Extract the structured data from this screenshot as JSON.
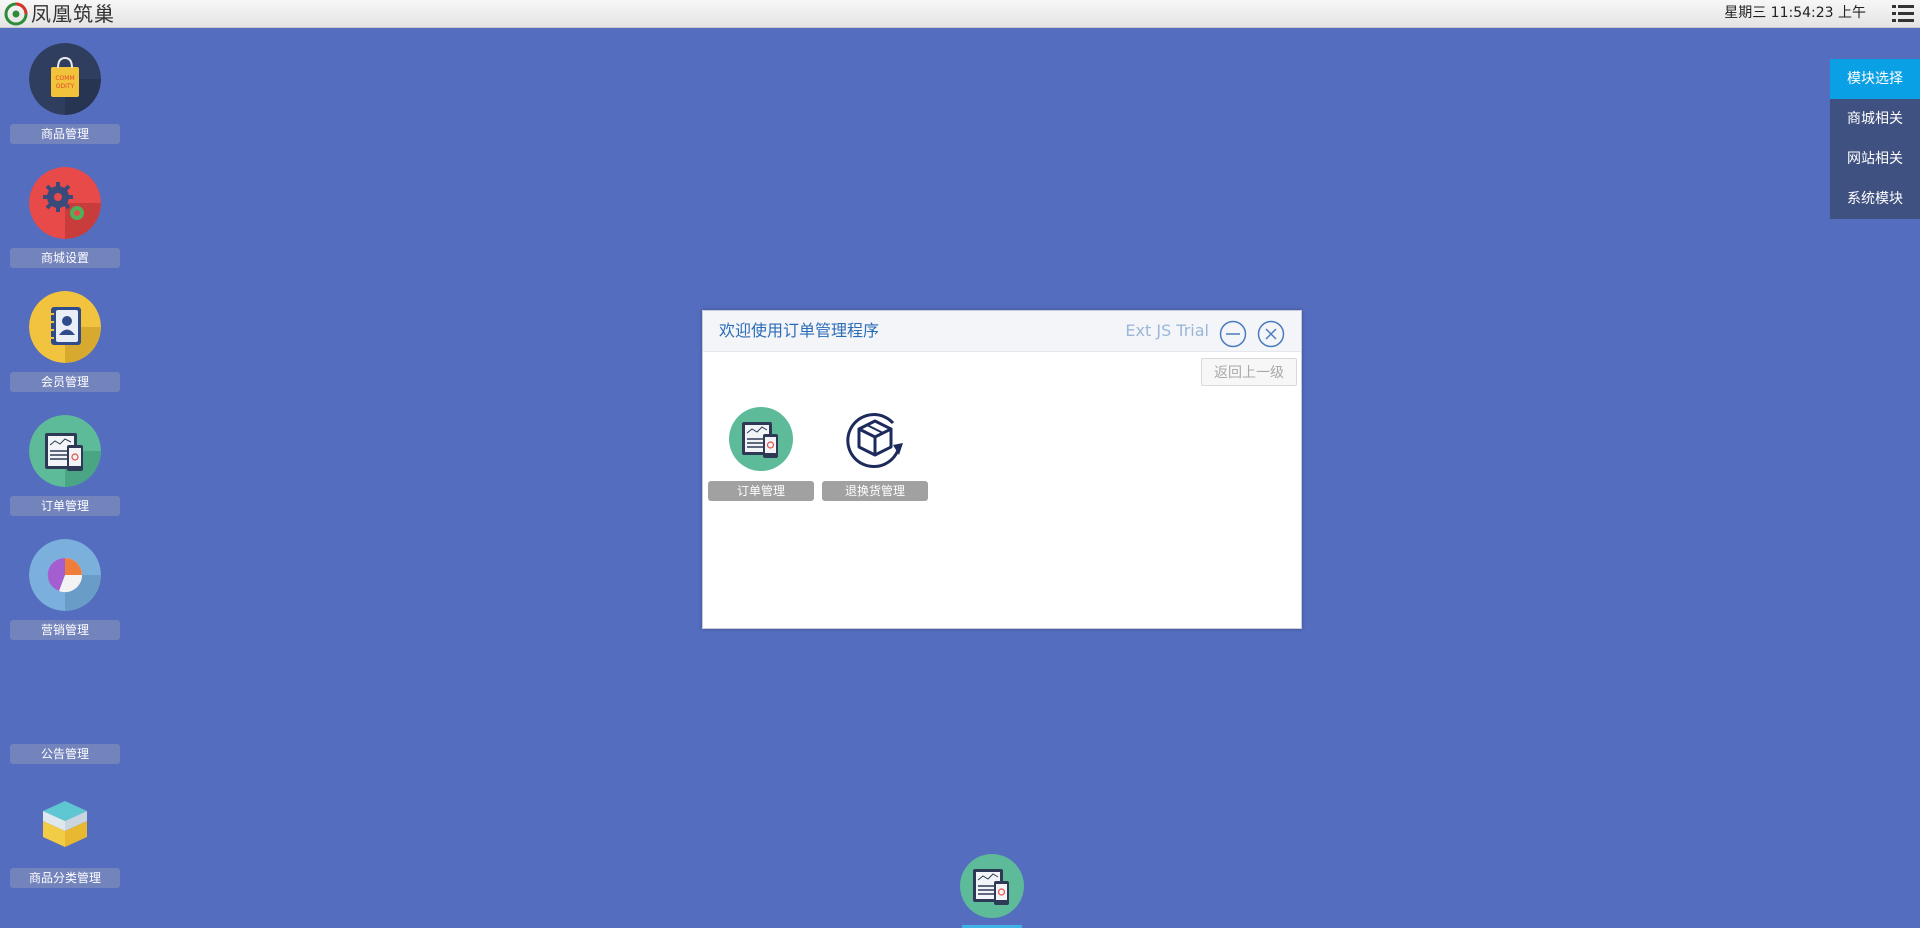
{
  "topbar": {
    "logo_text": "凤凰筑巢",
    "clock": "星期三 11:54:23 上午"
  },
  "desktop_icons": [
    {
      "label": "商品管理",
      "icon": "shopping-bag-icon",
      "badge_text": "COMM ODITY"
    },
    {
      "label": "商城设置",
      "icon": "gears-icon"
    },
    {
      "label": "会员管理",
      "icon": "contact-book-icon"
    },
    {
      "label": "订单管理",
      "icon": "order-tablet-icon"
    },
    {
      "label": "营销管理",
      "icon": "pie-chart-icon"
    },
    {
      "label": "公告管理",
      "icon": ""
    },
    {
      "label": "商品分类管理",
      "icon": "category-box-icon"
    }
  ],
  "module_menu": {
    "items": [
      "模块选择",
      "商城相关",
      "网站相关",
      "系统模块"
    ],
    "active_index": 0
  },
  "window": {
    "title": "欢迎使用订单管理程序",
    "trial": "Ext JS Trial",
    "back_button": "返回上一级",
    "apps": [
      {
        "label": "订单管理",
        "icon": "order-tablet-icon"
      },
      {
        "label": "退换货管理",
        "icon": "return-box-icon"
      }
    ]
  },
  "colors": {
    "desktop_bg": "#546dbf",
    "accent": "#0aa0e6",
    "menu_bg": "#3f5180",
    "title_blue": "#2b6cb8"
  }
}
